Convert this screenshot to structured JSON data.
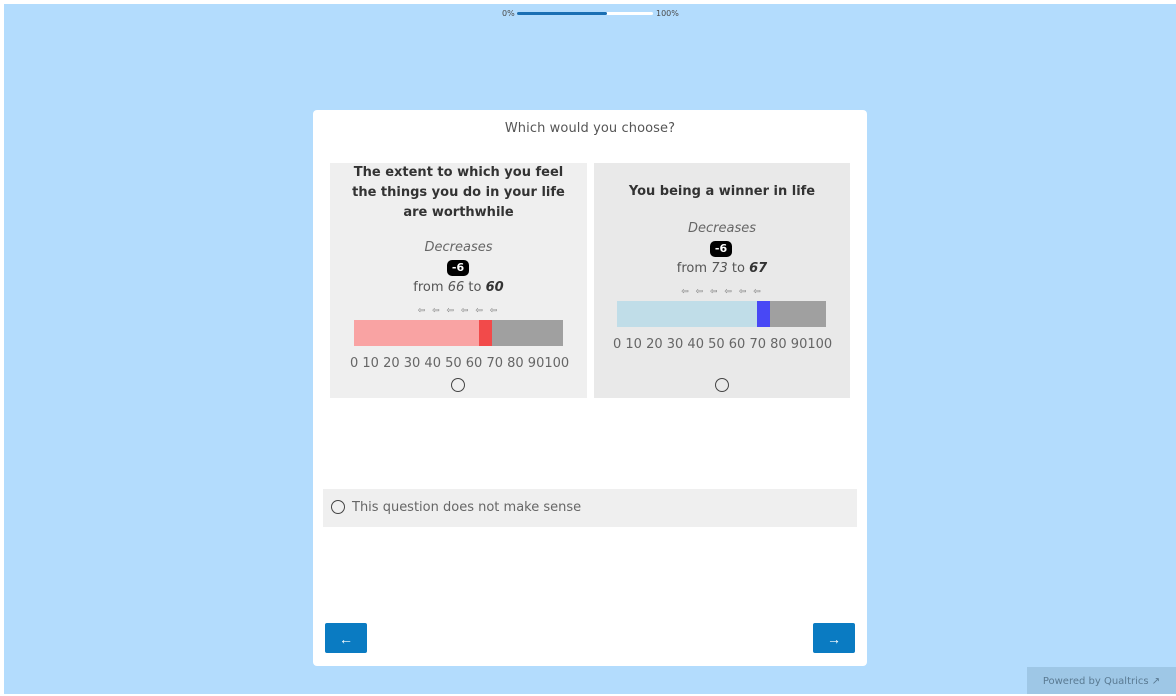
{
  "progress": {
    "start_label": "0%",
    "end_label": "100%",
    "fraction": 0.66
  },
  "question": "Which would you choose?",
  "options": [
    {
      "title": "The extent to which you feel the things you do in your life are worthwhile",
      "direction": "Decreases",
      "change": "-6",
      "from_prefix": "from",
      "from": "66",
      "to_word": "to",
      "to": "60",
      "arrows": "⇦ ⇦ ⇦ ⇦ ⇦ ⇦",
      "scale": "0 10 20 30 40 50 60 70 80 90100",
      "fill_color": "#f9a3a3",
      "marker_color": "#f24a4a"
    },
    {
      "title": "You being a winner in life",
      "direction": "Decreases",
      "change": "-6",
      "from_prefix": "from",
      "from": "73",
      "to_word": "to",
      "to": "67",
      "arrows": "⇦ ⇦ ⇦ ⇦ ⇦ ⇦",
      "scale": "0 10 20 30 40 50 60 70 80 90100",
      "fill_color": "#c0dde8",
      "marker_color": "#4848f5"
    }
  ],
  "no_sense_label": "This question does not make sense",
  "nav": {
    "back": "←",
    "next": "→"
  },
  "footer": {
    "powered": "Powered by Qualtrics ↗"
  }
}
